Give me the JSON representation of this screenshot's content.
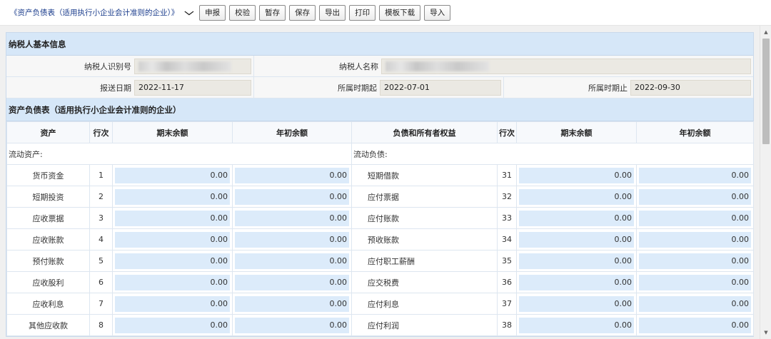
{
  "toolbar": {
    "form_select": "《资产负债表（适用执行小企业会计准则的企业）》",
    "buttons": [
      "申报",
      "校验",
      "暂存",
      "保存",
      "导出",
      "打印",
      "模板下载",
      "导入"
    ]
  },
  "taxpayer": {
    "section_title": "纳税人基本信息",
    "id_label": "纳税人识别号",
    "id_value": "",
    "name_label": "纳税人名称",
    "name_value": "",
    "submit_date_label": "报送日期",
    "submit_date": "2022-11-17",
    "period_start_label": "所属时期起",
    "period_start": "2022-07-01",
    "period_end_label": "所属时期止",
    "period_end": "2022-09-30"
  },
  "balance_sheet": {
    "section_title": "资产负债表（适用执行小企业会计准则的企业）",
    "headers": [
      "资产",
      "行次",
      "期末余额",
      "年初余额",
      "负债和所有者权益",
      "行次",
      "期末余额",
      "年初余额"
    ],
    "left_category": "流动资产:",
    "right_category": "流动负债:",
    "rows": [
      {
        "asset": "货币资金",
        "a_line": "1",
        "a_end": "0.00",
        "a_begin": "0.00",
        "liab": "短期借款",
        "l_line": "31",
        "l_end": "0.00",
        "l_begin": "0.00"
      },
      {
        "asset": "短期投资",
        "a_line": "2",
        "a_end": "0.00",
        "a_begin": "0.00",
        "liab": "应付票据",
        "l_line": "32",
        "l_end": "0.00",
        "l_begin": "0.00"
      },
      {
        "asset": "应收票据",
        "a_line": "3",
        "a_end": "0.00",
        "a_begin": "0.00",
        "liab": "应付账款",
        "l_line": "33",
        "l_end": "0.00",
        "l_begin": "0.00"
      },
      {
        "asset": "应收账款",
        "a_line": "4",
        "a_end": "0.00",
        "a_begin": "0.00",
        "liab": "预收账款",
        "l_line": "34",
        "l_end": "0.00",
        "l_begin": "0.00"
      },
      {
        "asset": "预付账款",
        "a_line": "5",
        "a_end": "0.00",
        "a_begin": "0.00",
        "liab": "应付职工薪酬",
        "l_line": "35",
        "l_end": "0.00",
        "l_begin": "0.00"
      },
      {
        "asset": "应收股利",
        "a_line": "6",
        "a_end": "0.00",
        "a_begin": "0.00",
        "liab": "应交税费",
        "l_line": "36",
        "l_end": "0.00",
        "l_begin": "0.00"
      },
      {
        "asset": "应收利息",
        "a_line": "7",
        "a_end": "0.00",
        "a_begin": "0.00",
        "liab": "应付利息",
        "l_line": "37",
        "l_end": "0.00",
        "l_begin": "0.00"
      },
      {
        "asset": "其他应收款",
        "a_line": "8",
        "a_end": "0.00",
        "a_begin": "0.00",
        "liab": "应付利润",
        "l_line": "38",
        "l_end": "0.00",
        "l_begin": "0.00"
      }
    ]
  }
}
